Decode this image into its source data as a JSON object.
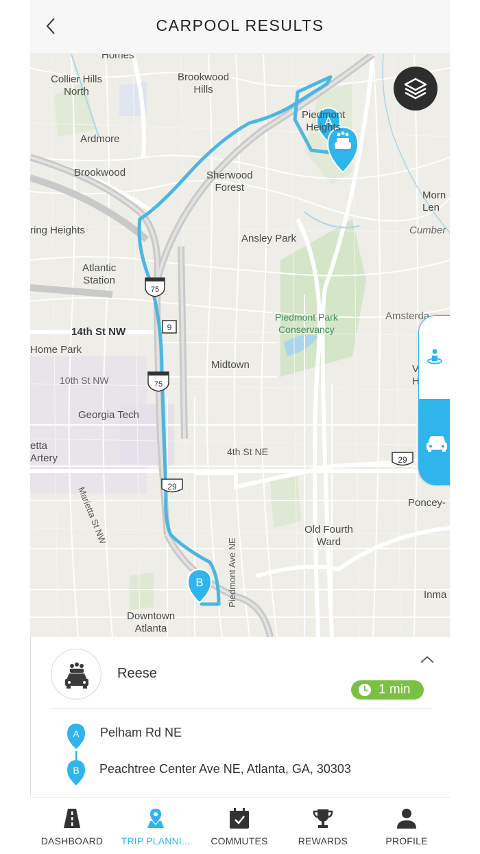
{
  "header": {
    "title": "CARPOOL RESULTS",
    "back_icon": "chevron-left-icon"
  },
  "map": {
    "layers_icon": "layers-icon",
    "labels": {
      "homes": "Homes",
      "collier_hills_north": "Collier Hills\nNorth",
      "brookwood_hills": "Brookwood\nHills",
      "piedmont_heights": "Piedmont\nHeights",
      "ardmore": "Ardmore",
      "brookwood": "Brookwood",
      "sherwood_forest": "Sherwood\nForest",
      "morningside_lenox": "Morn\nLen",
      "cumberland": "Cumber",
      "loring_heights": "ring Heights",
      "ansley_park": "Ansley Park",
      "atlantic_station": "Atlantic\nStation",
      "amsterdam": "Amsterda",
      "piedmont_park": "Piedmont Park\nConservancy",
      "fourteenth_st": "14th St NW",
      "home_park": "Home Park",
      "midtown": "Midtown",
      "virginia_highland": "V\nH",
      "tenth_st": "10th St NW",
      "georgia_tech": "Georgia Tech",
      "marietta_artery": "etta\nArtery",
      "fourth_st": "4th St NE",
      "marietta_st": "Marietta St NW",
      "poncey": "Poncey-",
      "old_fourth_ward": "Old Fourth\nWard",
      "piedmont_ave": "Piedmont Ave NE",
      "inman": "Inma",
      "downtown": "Downtown\nAtlanta"
    },
    "shields": {
      "i75_top": "75",
      "sr9": "9",
      "i75_mid": "75",
      "us29_left": "29",
      "us29_right": "29"
    },
    "pin_a": "A",
    "pin_b": "B",
    "route_color": "#4db6e0",
    "side_tabs": {
      "walk_icon": "person-pin-icon",
      "car_icon": "car-icon"
    }
  },
  "card": {
    "driver_name": "Reese",
    "avatar_icon": "carpool-icon",
    "expand_icon": "chevron-up-icon",
    "time_icon": "clock-icon",
    "time_text": "1 min",
    "stop_a_label": "A",
    "stop_a": "Pelham Rd NE",
    "stop_b_label": "B",
    "stop_b": "Peachtree Center Ave NE, Atlanta, GA, 30303"
  },
  "nav": {
    "items": [
      {
        "label": "DASHBOARD",
        "icon": "road-icon"
      },
      {
        "label": "TRIP PLANNI...",
        "icon": "map-pin-icon",
        "active": true
      },
      {
        "label": "COMMUTES",
        "icon": "calendar-check-icon"
      },
      {
        "label": "REWARDS",
        "icon": "trophy-icon"
      },
      {
        "label": "PROFILE",
        "icon": "person-icon"
      }
    ]
  },
  "colors": {
    "accent": "#2fb5ec",
    "badge_green": "#7bc043",
    "map_bg": "#eeede7",
    "route": "#4db6e0"
  }
}
